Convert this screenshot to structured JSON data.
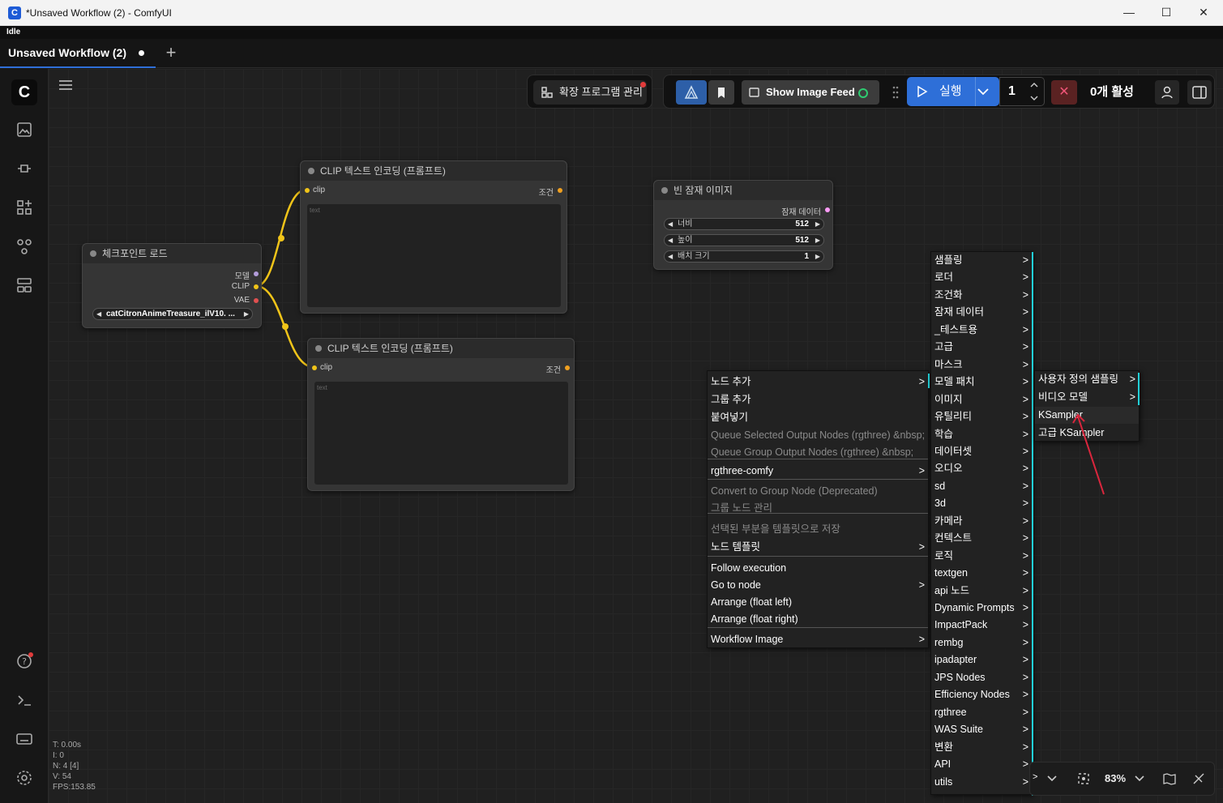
{
  "window": {
    "title": "*Unsaved Workflow (2) - ComfyUI",
    "app_icon": "C"
  },
  "status": "Idle",
  "tab": {
    "label": "Unsaved Workflow (2)",
    "add": "+"
  },
  "toolbar": {
    "extensions_label": "확장 프로그램 관리",
    "show_image_feed": "Show Image Feed",
    "run_label": "실행",
    "queue_count": "1",
    "active_label": "0개 활성"
  },
  "nodes": {
    "clip1": {
      "title": "CLIP 텍스트 인코딩 (프롬프트)",
      "input": "clip",
      "output": "조건",
      "placeholder": "text"
    },
    "clip2": {
      "title": "CLIP 텍스트 인코딩 (프롬프트)",
      "input": "clip",
      "output": "조건",
      "placeholder": "text"
    },
    "checkpoint": {
      "title": "체크포인트 로드",
      "outputs": [
        "모델",
        "CLIP",
        "VAE"
      ],
      "ckpt": "catCitronAnimeTreasure_ilV10. ..."
    },
    "latent": {
      "title": "빈 잠재 이미지",
      "output": "잠재 데이터",
      "widgets": [
        {
          "label": "너비",
          "value": "512"
        },
        {
          "label": "높이",
          "value": "512"
        },
        {
          "label": "배치 크기",
          "value": "1"
        }
      ]
    }
  },
  "context_menu": {
    "items": [
      {
        "label": "노드 추가",
        "sub": true,
        "dis": false
      },
      {
        "label": "그룹 추가",
        "sub": false,
        "dis": false
      },
      {
        "label": "붙여넣기",
        "sub": false,
        "dis": false
      },
      {
        "label": "Queue Selected Output Nodes (rgthree) &nbsp;",
        "sub": false,
        "dis": true
      },
      {
        "label": "Queue Group Output Nodes (rgthree) &nbsp;",
        "sub": false,
        "dis": true
      },
      {
        "label": "rgthree-comfy",
        "sub": true,
        "dis": false
      },
      {
        "label": "Convert to Group Node (Deprecated)",
        "sub": false,
        "dis": true
      },
      {
        "label": "그룹 노드 관리",
        "sub": false,
        "dis": true
      },
      {
        "label": "선택된 부분을 템플릿으로 저장",
        "sub": false,
        "dis": true
      },
      {
        "label": "노드 템플릿",
        "sub": true,
        "dis": false
      },
      {
        "label": "Follow execution",
        "sub": false,
        "dis": false
      },
      {
        "label": "Go to node",
        "sub": true,
        "dis": false
      },
      {
        "label": "Arrange (float left)",
        "sub": false,
        "dis": false
      },
      {
        "label": "Arrange (float right)",
        "sub": false,
        "dis": false
      },
      {
        "label": "Workflow Image",
        "sub": true,
        "dis": false
      }
    ]
  },
  "category_menu": {
    "items": [
      "샘플링",
      "로더",
      "조건화",
      "잠재 데이터",
      "_테스트용",
      "고급",
      "마스크",
      "모델 패치",
      "이미지",
      "유틸리티",
      "학습",
      "데이터셋",
      "오디오",
      "sd",
      "3d",
      "카메라",
      "컨텍스트",
      "로직",
      "textgen",
      "api 노드",
      "Dynamic Prompts",
      "ImpactPack",
      "rembg",
      "ipadapter",
      "JPS Nodes",
      "Efficiency Nodes",
      "rgthree",
      "WAS Suite",
      "변환",
      "API",
      "utils"
    ]
  },
  "sampling_menu": {
    "items": [
      {
        "label": "사용자 정의 샘플링",
        "sub": true
      },
      {
        "label": "비디오 모델",
        "sub": true
      },
      {
        "label": "KSampler",
        "sub": false
      },
      {
        "label": "고급 KSampler",
        "sub": false
      }
    ]
  },
  "zoom": "83%",
  "stats": [
    "T: 0.00s",
    "I: 0",
    "N: 4 [4]",
    "V: 54",
    "FPS:153.85"
  ],
  "colors": {
    "accent": "#2e6fd8",
    "clip_wire": "#f0c419",
    "cyan": "#22d0d8"
  }
}
